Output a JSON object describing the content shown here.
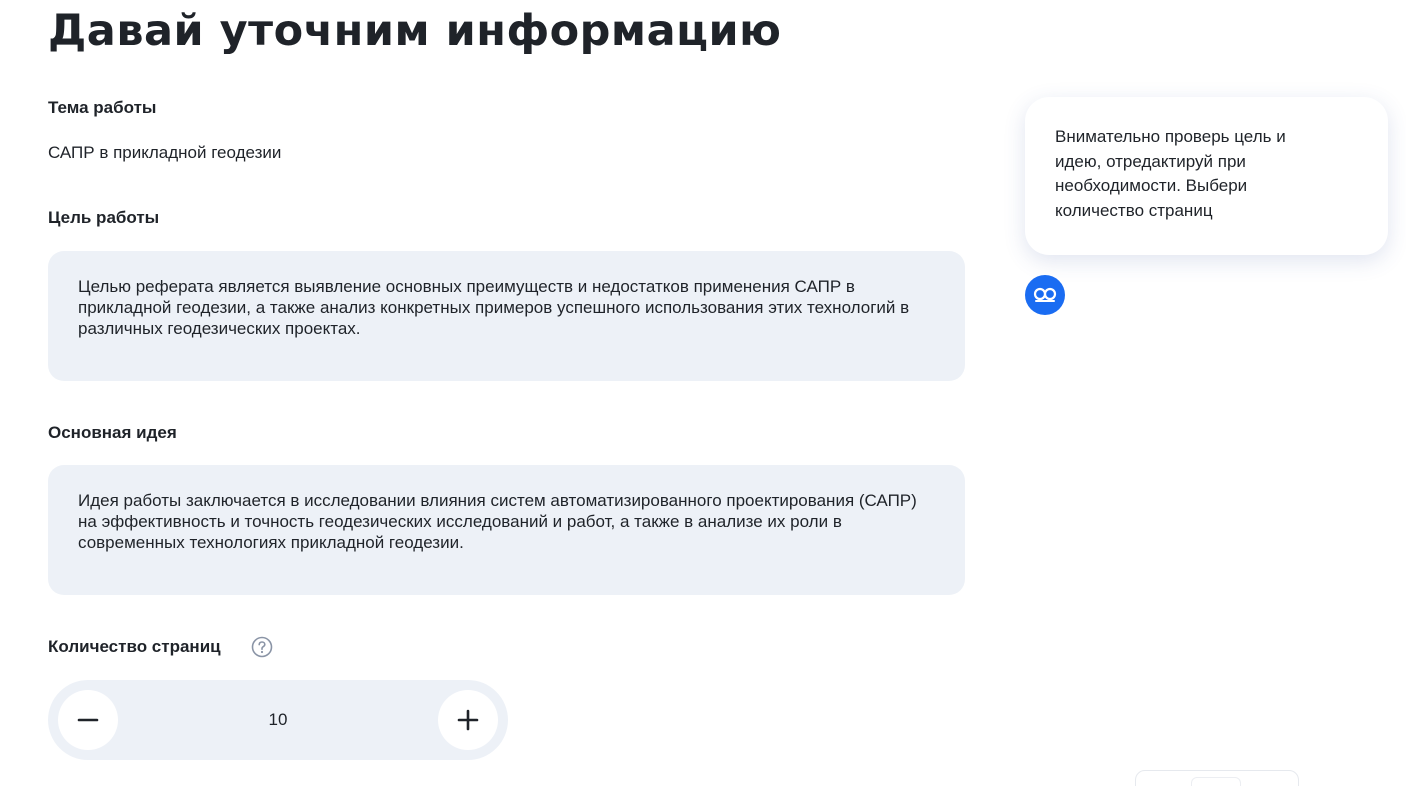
{
  "page": {
    "title": "Давай уточним информацию"
  },
  "topic": {
    "label": "Тема работы",
    "value": "САПР в прикладной геодезии"
  },
  "goal": {
    "label": "Цель работы",
    "value": "Целью реферата является выявление основных преимуществ и недостатков применения САПР в прикладной геодезии, а также анализ конкретных примеров успешного использования этих технологий в различных геодезических проектах."
  },
  "idea": {
    "label": "Основная идея",
    "value": "Идея работы заключается в исследовании влияния систем автоматизированного проектирования (САПР) на эффективность и точность геодезических исследований и работ, а также в анализе их роли в современных технологиях прикладной геодезии."
  },
  "pages": {
    "label": "Количество страниц",
    "value": "10",
    "icons": {
      "help": "question-circle-icon",
      "decrease": "minus-icon",
      "increase": "plus-icon"
    }
  },
  "assistant": {
    "tip": "Внимательно проверь цель и идею, отредактируй при необходимости. Выбери количество страниц",
    "avatar_icon": "assistant-logo-icon"
  },
  "colors": {
    "accent": "#1a6cf2",
    "card_background": "#edf1f7",
    "text": "#1f2329",
    "help_icon": "#8a94a6"
  }
}
